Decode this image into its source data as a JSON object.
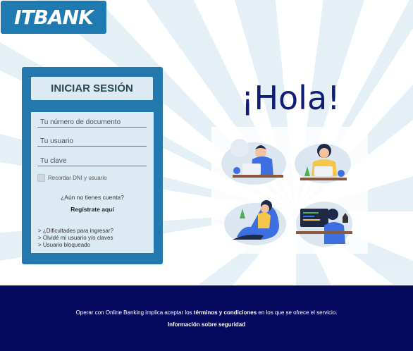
{
  "brand": {
    "logo_text": "ITBANK",
    "color": "#1e7ab0"
  },
  "login": {
    "title": "INICIAR SESIÓN",
    "document_placeholder": "Tu número de documento",
    "user_placeholder": "Tu usuario",
    "password_placeholder": "Tu clave",
    "remember_label": "Recordar DNI y usuario",
    "no_account": "¿Aún no tienes cuenta?",
    "register_link": "Regístrate aquí",
    "help_links": [
      "> ¿Dificultades para ingresar?",
      "> Olvidé mi usuario y/o claves",
      "> Usuario bloqueado"
    ]
  },
  "hero": {
    "greeting": "¡Hola!"
  },
  "footer": {
    "text_before": "Operar con Online Banking implica aceptar los ",
    "terms_link": "términos y condiciones",
    "text_after": " en los que se ofrece el servicio.",
    "security_link": "Información sobre seguridad",
    "background": "#050a5e"
  },
  "colors": {
    "card": "#2378ae",
    "panel": "#dbeaf3",
    "greeting": "#0f1d74"
  },
  "icons": [
    "logo",
    "checkbox",
    "people-working-illustration"
  ]
}
